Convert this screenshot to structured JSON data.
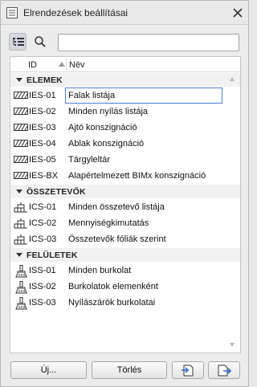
{
  "window": {
    "title": "Elrendezések beállításai"
  },
  "toolbar": {
    "view_toggle_icon": "tree-list-icon",
    "search_icon": "search-icon",
    "search_value": "",
    "search_placeholder": ""
  },
  "list": {
    "columns": {
      "id": "ID",
      "name": "Név"
    },
    "sort_column": "ID",
    "sort_direction": "ascending",
    "groups": [
      {
        "label": "ELEMEK",
        "icon": "hatch-pattern-icon",
        "items": [
          {
            "id": "IES-01",
            "name": "Falak listája",
            "selected": true
          },
          {
            "id": "IES-02",
            "name": "Minden nyílás listája"
          },
          {
            "id": "IES-03",
            "name": "Ajtó konszignáció"
          },
          {
            "id": "IES-04",
            "name": "Ablak konszignáció"
          },
          {
            "id": "IES-05",
            "name": "Tárgyleltár"
          },
          {
            "id": "IES-BX",
            "name": "Alapértelmezett BIMx konszignáció"
          }
        ]
      },
      {
        "label": "ÖSSZETEVŐK",
        "icon": "components-icon",
        "items": [
          {
            "id": "ICS-01",
            "name": "Minden összetevő listája"
          },
          {
            "id": "ICS-02",
            "name": "Mennyiségkimutatás"
          },
          {
            "id": "ICS-03",
            "name": "Összetevők fóliák szerint"
          }
        ]
      },
      {
        "label": "FELÜLETEK",
        "icon": "paint-brush-icon",
        "items": [
          {
            "id": "ISS-01",
            "name": "Minden burkolat"
          },
          {
            "id": "ISS-02",
            "name": "Burkolatok elemenként"
          },
          {
            "id": "ISS-03",
            "name": "Nyílászárók burkolatai"
          }
        ]
      }
    ]
  },
  "buttons": {
    "new_label": "Új...",
    "delete_label": "Törlés",
    "import_icon": "import-icon",
    "export_icon": "export-icon"
  }
}
